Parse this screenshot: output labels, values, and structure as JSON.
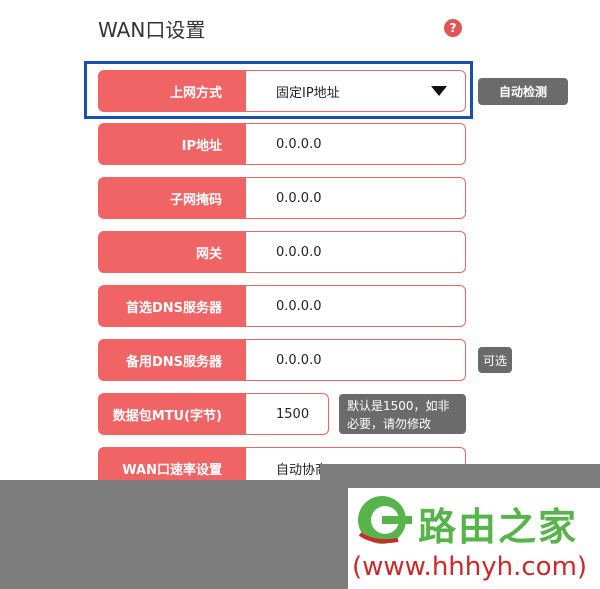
{
  "page": {
    "title": "WAN口设置",
    "help": "?"
  },
  "form": {
    "rows": [
      {
        "label": "上网方式",
        "value": "固定IP地址"
      },
      {
        "label": "IP地址",
        "value": "0.0.0.0"
      },
      {
        "label": "子网掩码",
        "value": "0.0.0.0"
      },
      {
        "label": "网关",
        "value": "0.0.0.0"
      },
      {
        "label": "首选DNS服务器",
        "value": "0.0.0.0"
      },
      {
        "label": "备用DNS服务器",
        "value": "0.0.0.0"
      },
      {
        "label": "数据包MTU(字节)",
        "value": "1500"
      },
      {
        "label": "WAN口速率设置",
        "value": "自动协商"
      }
    ]
  },
  "buttons": {
    "auto_detect": "自动检测",
    "optional": "可选"
  },
  "tooltip": {
    "mtu_line1": "默认是1500，如非",
    "mtu_line2": "必要，请勿修改"
  },
  "watermark": {
    "title": "路由之家",
    "url": "(www.hhhyh.com)"
  },
  "colors": {
    "label_bg": "#f06465",
    "highlight_border": "#1a4fae",
    "button_bg": "#6b6b6b"
  }
}
